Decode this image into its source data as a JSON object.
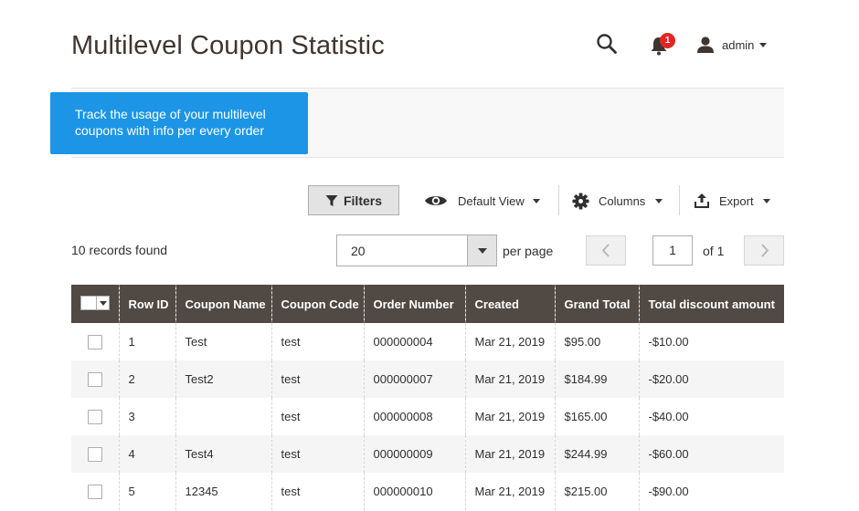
{
  "page": {
    "title": "Multilevel Coupon Statistic"
  },
  "header": {
    "search_icon": "search-icon",
    "notifications": {
      "icon": "bell-icon",
      "count": "1"
    },
    "user": {
      "icon": "user-icon",
      "name": "admin"
    }
  },
  "banner": {
    "text": "Track the usage of your multilevel coupons with info per every order",
    "color": "#1c95e6"
  },
  "toolbar": {
    "filters_label": "Filters",
    "view_label": "Default View",
    "columns_label": "Columns",
    "export_label": "Export"
  },
  "grid_info": {
    "records": "10 records found",
    "per_page_value": "20",
    "per_page_label": "per page",
    "current_page": "1",
    "of_pages": "of 1"
  },
  "table": {
    "columns": [
      "Row ID",
      "Coupon Name",
      "Coupon Code",
      "Order Number",
      "Created",
      "Grand Total",
      "Total discount amount"
    ],
    "rows": [
      [
        "1",
        "Test",
        "test",
        "000000004",
        "Mar 21, 2019",
        "$95.00",
        "-$10.00"
      ],
      [
        "2",
        "Test2",
        "test",
        "000000007",
        "Mar 21, 2019",
        "$184.99",
        "-$20.00"
      ],
      [
        "3",
        "",
        "test",
        "000000008",
        "Mar 21, 2019",
        "$165.00",
        "-$40.00"
      ],
      [
        "4",
        "Test4",
        "test",
        "000000009",
        "Mar 21, 2019",
        "$244.99",
        "-$60.00"
      ],
      [
        "5",
        "12345",
        "test",
        "000000010",
        "Mar 21, 2019",
        "$215.00",
        "-$90.00"
      ]
    ]
  },
  "colors": {
    "header_bg": "#514943",
    "accent": "#1c95e6",
    "badge": "#e22626"
  }
}
